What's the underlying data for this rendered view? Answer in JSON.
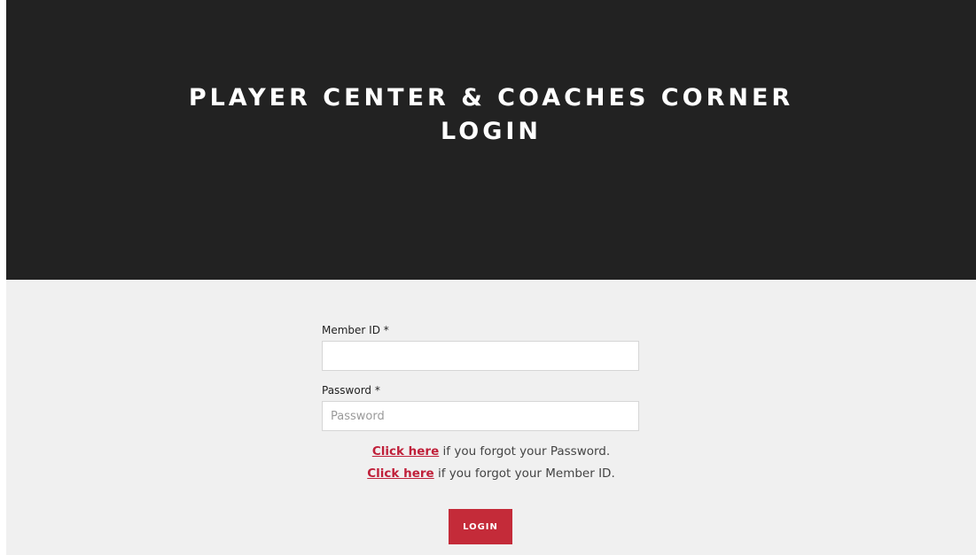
{
  "hero": {
    "title_line1": "PLAYER CENTER & COACHES CORNER",
    "title_line2": "LOGIN"
  },
  "form": {
    "member_id": {
      "label": "Member ID *",
      "value": "",
      "placeholder": ""
    },
    "password": {
      "label": "Password *",
      "value": "",
      "placeholder": "Password"
    },
    "forgot_password": {
      "link_text": "Click here",
      "text": " if you forgot your Password."
    },
    "forgot_member_id": {
      "link_text": "Click here",
      "text": " if you forgot your Member ID."
    },
    "submit_label": "LOGIN"
  },
  "colors": {
    "hero_background": "#222222",
    "form_background": "#f0f0f0",
    "accent": "#c42b39",
    "link": "#c0203a"
  }
}
